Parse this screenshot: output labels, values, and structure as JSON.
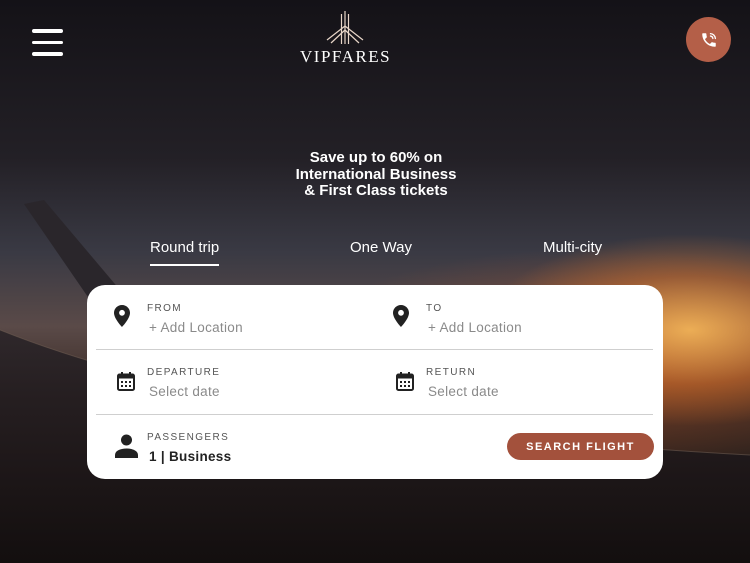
{
  "brand": {
    "name": "VIPFARES",
    "accent_color": "#b45f48",
    "button_color": "#a3513c"
  },
  "header": {
    "menu_icon": "hamburger-menu-icon",
    "phone_icon": "phone-call-icon"
  },
  "headline": {
    "line1": "Save up to 60% on",
    "line2": "International Business",
    "line3": "& First Class tickets"
  },
  "tabs": [
    {
      "label": "Round trip",
      "active": true
    },
    {
      "label": "One Way",
      "active": false
    },
    {
      "label": "Multi-city",
      "active": false
    }
  ],
  "form": {
    "from": {
      "label": "FROM",
      "value": "+ Add Location",
      "icon": "location-pin-icon"
    },
    "to": {
      "label": "TO",
      "value": "+ Add Location",
      "icon": "location-pin-icon"
    },
    "departure": {
      "label": "DEPARTURE",
      "value": "Select date",
      "icon": "calendar-icon"
    },
    "return": {
      "label": "RETURN",
      "value": "Select date",
      "icon": "calendar-icon"
    },
    "passengers": {
      "label": "PASSENGERS",
      "value": "1 | Business",
      "icon": "person-icon"
    },
    "search_label": "SEARCH FLIGHT"
  }
}
